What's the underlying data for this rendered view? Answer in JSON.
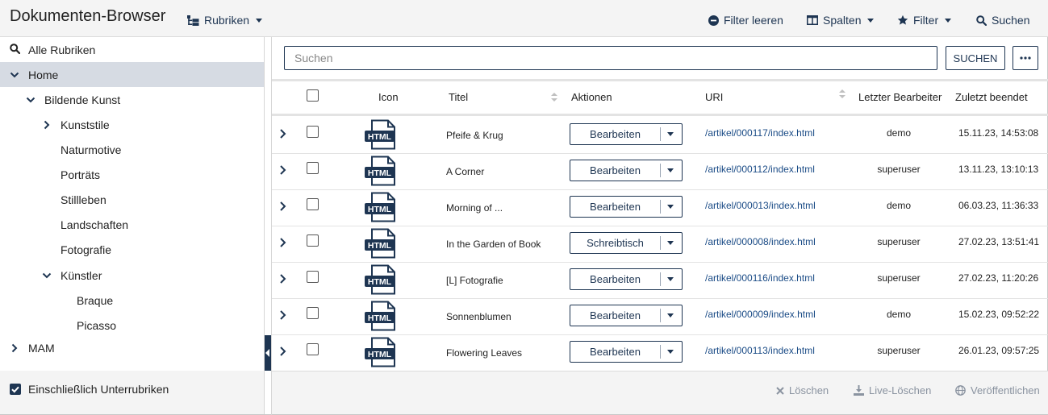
{
  "header": {
    "title": "Dokumenten-Browser",
    "rubriken_label": "Rubriken",
    "filter_clear_label": "Filter leeren",
    "columns_label": "Spalten",
    "filter_label": "Filter",
    "search_label": "Suchen"
  },
  "sidebar": {
    "all_label": "Alle Rubriken",
    "tree": [
      {
        "label": "Home",
        "depth": 0,
        "state": "expanded",
        "selected": true
      },
      {
        "label": "Bildende Kunst",
        "depth": 1,
        "state": "expanded"
      },
      {
        "label": "Kunststile",
        "depth": 2,
        "state": "collapsed"
      },
      {
        "label": "Naturmotive",
        "depth": 2,
        "state": "leaf"
      },
      {
        "label": "Porträts",
        "depth": 2,
        "state": "leaf"
      },
      {
        "label": "Stillleben",
        "depth": 2,
        "state": "leaf"
      },
      {
        "label": "Landschaften",
        "depth": 2,
        "state": "leaf"
      },
      {
        "label": "Fotografie",
        "depth": 2,
        "state": "leaf"
      },
      {
        "label": "Künstler",
        "depth": 2,
        "state": "expanded"
      },
      {
        "label": "Braque",
        "depth": 3,
        "state": "leaf"
      },
      {
        "label": "Picasso",
        "depth": 3,
        "state": "leaf"
      },
      {
        "label": "MAM",
        "depth": 0,
        "state": "collapsed"
      }
    ],
    "include_sub_label": "Einschließlich Unterrubriken",
    "include_sub_checked": true
  },
  "search": {
    "placeholder": "Suchen",
    "button_label": "SUCHEN"
  },
  "table": {
    "columns": {
      "icon": "Icon",
      "title": "Titel",
      "actions": "Aktionen",
      "uri": "URI",
      "editor": "Letzter Bearbeiter",
      "finished": "Zuletzt beendet"
    },
    "file_icon_label": "HTML",
    "rows": [
      {
        "title": "Pfeife & Krug",
        "action": "Bearbeiten",
        "uri": "/artikel/000117/index.html",
        "editor": "demo",
        "finished": "15.11.23, 14:53:08"
      },
      {
        "title": "A Corner",
        "action": "Bearbeiten",
        "uri": "/artikel/000112/index.html",
        "editor": "superuser",
        "finished": "13.11.23, 13:10:13"
      },
      {
        "title": "Morning of ...",
        "action": "Bearbeiten",
        "uri": "/artikel/000013/index.html",
        "editor": "demo",
        "finished": "06.03.23, 11:36:33"
      },
      {
        "title": "In the Garden of Book",
        "action": "Schreibtisch",
        "uri": "/artikel/000008/index.html",
        "editor": "superuser",
        "finished": "27.02.23, 13:51:41"
      },
      {
        "title": "[L] Fotografie",
        "action": "Bearbeiten",
        "uri": "/artikel/000116/index.html",
        "editor": "superuser",
        "finished": "27.02.23, 11:20:26"
      },
      {
        "title": "Sonnenblumen",
        "action": "Bearbeiten",
        "uri": "/artikel/000009/index.html",
        "editor": "demo",
        "finished": "15.02.23, 09:52:22"
      },
      {
        "title": "Flowering Leaves",
        "action": "Bearbeiten",
        "uri": "/artikel/000113/index.html",
        "editor": "superuser",
        "finished": "26.01.23, 09:57:25"
      }
    ]
  },
  "bottombar": {
    "delete_label": "Löschen",
    "live_delete_label": "Live-Löschen",
    "publish_label": "Veröffentlichen"
  },
  "colors": {
    "accent": "#1e3552",
    "link": "#1a4b86",
    "selected_row": "#d6dbe3",
    "disabled": "#8a93a0"
  }
}
